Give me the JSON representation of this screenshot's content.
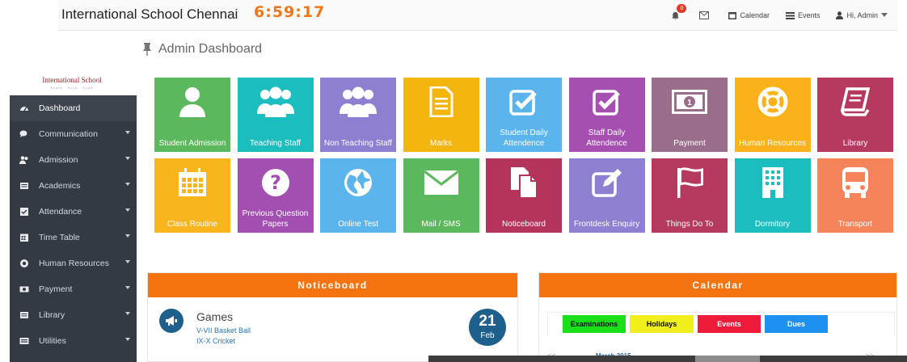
{
  "header": {
    "title": "International School Chennai",
    "clock": "6:59:17",
    "notification_count": "0",
    "calendar_label": "Calendar",
    "events_label": "Events",
    "user_label": "Hi, Admin"
  },
  "page": {
    "title": "Admin Dashboard"
  },
  "logo": {
    "name": "International School",
    "tagline": "Learn · Grow · Lead"
  },
  "sidebar": {
    "items": [
      {
        "label": "Dashboard",
        "icon": "dashboard-icon",
        "dropdown": false
      },
      {
        "label": "Communication",
        "icon": "comments-icon",
        "dropdown": true
      },
      {
        "label": "Admission",
        "icon": "users-icon",
        "dropdown": true
      },
      {
        "label": "Academics",
        "icon": "book-icon",
        "dropdown": true
      },
      {
        "label": "Attendance",
        "icon": "check-icon",
        "dropdown": true
      },
      {
        "label": "Time Table",
        "icon": "calendar-icon",
        "dropdown": true
      },
      {
        "label": "Human Resources",
        "icon": "lifebuoy-icon",
        "dropdown": true
      },
      {
        "label": "Payment",
        "icon": "money-icon",
        "dropdown": true
      },
      {
        "label": "Library",
        "icon": "book-icon",
        "dropdown": true
      },
      {
        "label": "Utilities",
        "icon": "utilities-icon",
        "dropdown": true
      }
    ]
  },
  "tiles": [
    {
      "label": "Student Admission",
      "icon": "user-icon",
      "color": "#5cb85c"
    },
    {
      "label": "Teaching Staff",
      "icon": "group-icon",
      "color": "#1bbdbf"
    },
    {
      "label": "Non Teaching Staff",
      "icon": "group-icon",
      "color": "#8f7fd0"
    },
    {
      "label": "Marks",
      "icon": "document-icon",
      "color": "#f5b50f"
    },
    {
      "label": "Student Daily Attendence",
      "icon": "checkbox-icon",
      "color": "#5bb4ec"
    },
    {
      "label": "Staff Daily Attendence",
      "icon": "checkbox-icon",
      "color": "#a54fb1"
    },
    {
      "label": "Payment",
      "icon": "money-icon",
      "color": "#9a6e8a"
    },
    {
      "label": "Human Resources",
      "icon": "lifebuoy-icon",
      "color": "#fbb21a"
    },
    {
      "label": "Library",
      "icon": "book-icon",
      "color": "#b53a5e"
    },
    {
      "label": "Class Routine",
      "icon": "calendar-icon",
      "color": "#f9b51d"
    },
    {
      "label": "Previous Question Papers",
      "icon": "question-icon",
      "color": "#a24fb1"
    },
    {
      "label": "Online Test",
      "icon": "globe-icon",
      "color": "#5bb4ec"
    },
    {
      "label": "Mail / SMS",
      "icon": "envelope-icon",
      "color": "#5cb85c"
    },
    {
      "label": "Noticeboard",
      "icon": "copy-icon",
      "color": "#b5345c"
    },
    {
      "label": "Frontdesk Enquiry",
      "icon": "edit-icon",
      "color": "#8f7fd0"
    },
    {
      "label": "Things Do To",
      "icon": "flag-icon",
      "color": "#b53a5e"
    },
    {
      "label": "Dormitory",
      "icon": "building-icon",
      "color": "#1bbdbf"
    },
    {
      "label": "Transport",
      "icon": "bus-icon",
      "color": "#f5845a"
    }
  ],
  "noticeboard": {
    "title": "Noticeboard",
    "item": {
      "title": "Games",
      "line1": "V-VII Basket Ball",
      "line2": "IX-X Cricket",
      "day": "21",
      "month": "Feb"
    }
  },
  "calendar": {
    "title": "Calendar",
    "legend": [
      "Examinations",
      "Holidays",
      "Events",
      "Dues"
    ],
    "month_label": "March 2015",
    "prev": "<<",
    "next": ">>"
  }
}
